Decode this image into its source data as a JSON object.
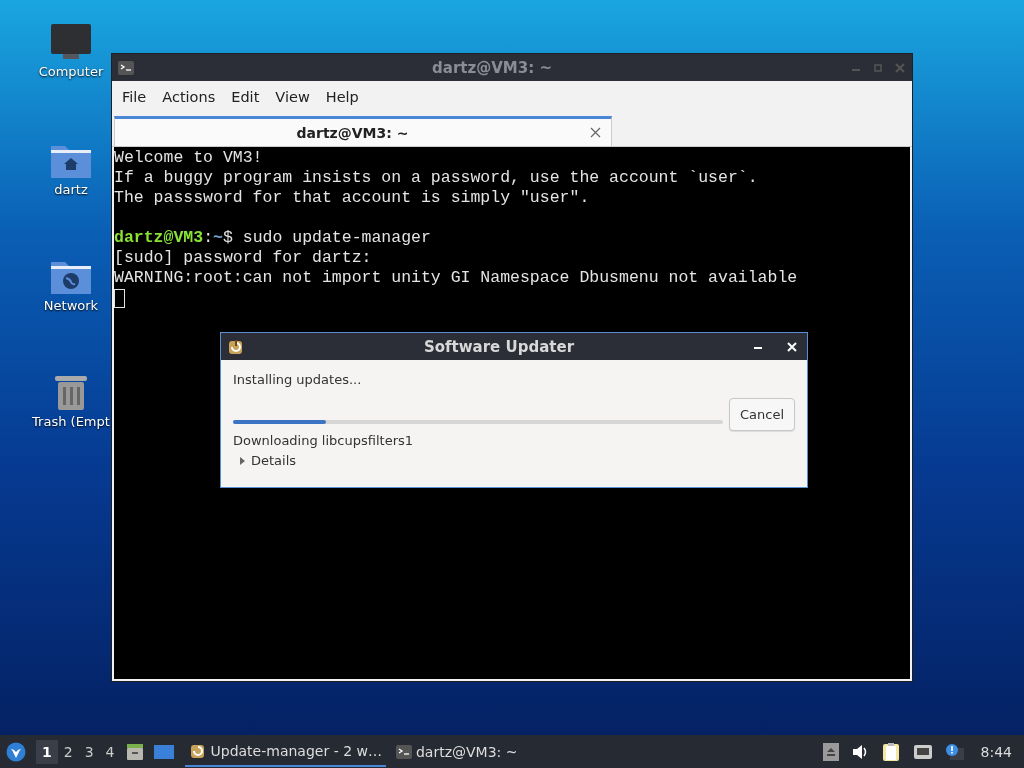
{
  "desktop_icons": [
    {
      "kind": "computer",
      "label": "Computer"
    },
    {
      "kind": "home",
      "label": "dartz"
    },
    {
      "kind": "network",
      "label": "Network"
    },
    {
      "kind": "trash",
      "label": "Trash (Empt"
    }
  ],
  "terminal_window": {
    "title": "dartz@VM3: ~",
    "menu": [
      "File",
      "Actions",
      "Edit",
      "View",
      "Help"
    ],
    "tabs": [
      {
        "label": "dartz@VM3: ~",
        "selected": true
      }
    ],
    "lines": [
      {
        "kind": "text",
        "text": "Welcome to VM3!"
      },
      {
        "kind": "text",
        "text": "If a buggy program insists on a password, use the account `user`."
      },
      {
        "kind": "text",
        "text": "The passsword for that account is simply \"user\"."
      },
      {
        "kind": "blank"
      },
      {
        "kind": "prompt",
        "user": "dartz@VM3",
        "sep": ":",
        "path": "~",
        "command": "$ sudo update-manager"
      },
      {
        "kind": "text",
        "text": "[sudo] password for dartz:"
      },
      {
        "kind": "text",
        "text": "WARNING:root:can not import unity GI Namespace Dbusmenu not available"
      },
      {
        "kind": "cursor"
      }
    ]
  },
  "dialog": {
    "title": "Software Updater",
    "status": "Installing updates...",
    "level": 0.19,
    "cancel": "Cancel",
    "detail": "Downloading libcupsfilters1",
    "details": {
      "label": "Details",
      "expanded": false
    }
  },
  "taskbar": {
    "workspaces": [
      {
        "label": "1",
        "selected": true
      },
      {
        "label": "2",
        "selected": false
      },
      {
        "label": "3",
        "selected": false
      },
      {
        "label": "4",
        "selected": false
      }
    ],
    "tasks": [
      {
        "kind": "updater",
        "label": "Update-manager - 2 w…",
        "selected": true
      },
      {
        "kind": "terminal",
        "label": "dartz@VM3: ~",
        "selected": false
      }
    ],
    "clock": "8:44"
  }
}
